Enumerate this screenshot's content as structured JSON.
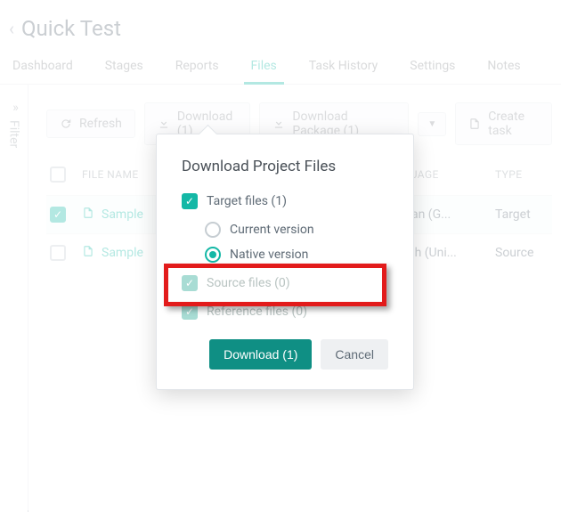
{
  "page": {
    "title": "Quick Test"
  },
  "tabs": [
    "Dashboard",
    "Stages",
    "Reports",
    "Files",
    "Task History",
    "Settings",
    "Notes"
  ],
  "active_tab": "Files",
  "filter": {
    "label": "Filter"
  },
  "toolbar": {
    "refresh": "Refresh",
    "download": "Download (1)",
    "download_package": "Download Package (1)",
    "create_task": "Create task"
  },
  "table": {
    "headers": {
      "name": "FILE NAME",
      "lang": "LANGUAGE",
      "type": "TYPE"
    },
    "rows": [
      {
        "name": "Sample",
        "lang": "German (G...",
        "type": "Target",
        "checked": true
      },
      {
        "name": "Sample",
        "lang": "English (Uni...",
        "type": "Source",
        "checked": false
      }
    ]
  },
  "dialog": {
    "title": "Download Project Files",
    "target": "Target files (1)",
    "current": "Current version",
    "native": "Native version",
    "source": "Source files (0)",
    "reference": "Reference files (0)",
    "download": "Download (1)",
    "cancel": "Cancel"
  }
}
